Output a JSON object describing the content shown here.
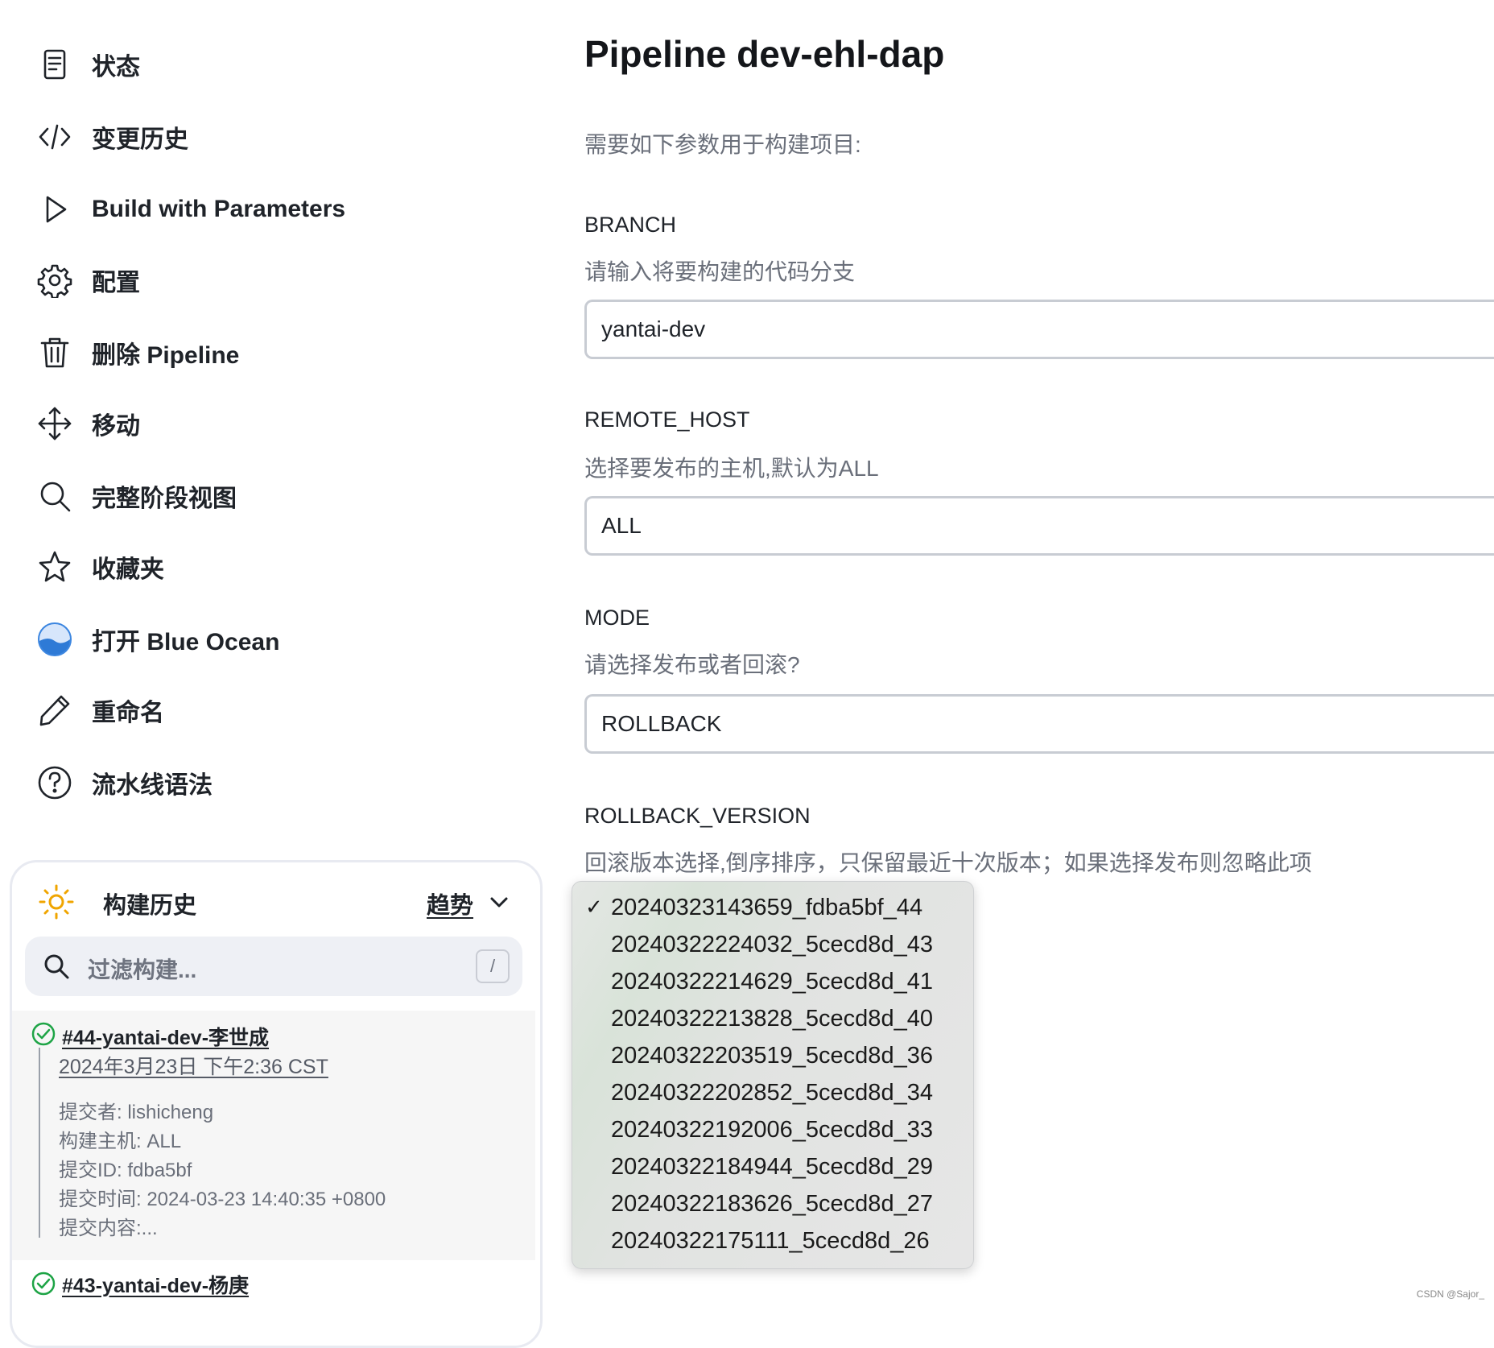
{
  "sidebar": {
    "items": [
      {
        "label": "状态",
        "icon": "document-icon"
      },
      {
        "label": "变更历史",
        "icon": "code-icon"
      },
      {
        "label": "Build with Parameters",
        "icon": "play-icon"
      },
      {
        "label": "配置",
        "icon": "gear-icon"
      },
      {
        "label": "删除 Pipeline",
        "icon": "trash-icon"
      },
      {
        "label": "移动",
        "icon": "move-icon"
      },
      {
        "label": "完整阶段视图",
        "icon": "search-icon"
      },
      {
        "label": "收藏夹",
        "icon": "star-icon"
      },
      {
        "label": "打开 Blue Ocean",
        "icon": "blue-ocean-icon"
      },
      {
        "label": "重命名",
        "icon": "pencil-icon"
      },
      {
        "label": "流水线语法",
        "icon": "help-icon"
      }
    ]
  },
  "build_history": {
    "title": "构建历史",
    "trend_label": "趋势",
    "search_placeholder": "过滤构建...",
    "search_shortcut": "/",
    "builds": [
      {
        "name": "#44-yantai-dev-李世成",
        "time": "2024年3月23日 下午2:36 CST",
        "details": [
          "提交者: lishicheng",
          "构建主机: ALL",
          "提交ID: fdba5bf",
          "提交时间: 2024-03-23 14:40:35 +0800",
          "提交内容:..."
        ]
      },
      {
        "name": "#43-yantai-dev-杨庚"
      }
    ]
  },
  "main": {
    "title": "Pipeline dev-ehl-dap",
    "intro": "需要如下参数用于构建项目:",
    "params": [
      {
        "name": "BRANCH",
        "description": "请输入将要构建的代码分支",
        "value": "yantai-dev"
      },
      {
        "name": "REMOTE_HOST",
        "description": "选择要发布的主机,默认为ALL",
        "value": "ALL"
      },
      {
        "name": "MODE",
        "description": "请选择发布或者回滚?",
        "value": "ROLLBACK"
      },
      {
        "name": "ROLLBACK_VERSION",
        "description": "回滚版本选择,倒序排序，只保留最近十次版本；如果选择发布则忽略此项"
      }
    ]
  },
  "dropdown": {
    "check_mark": "✓",
    "selected_index": 0,
    "options": [
      "20240323143659_fdba5bf_44",
      "20240322224032_5cecd8d_43",
      "20240322214629_5cecd8d_41",
      "20240322213828_5cecd8d_40",
      "20240322203519_5cecd8d_36",
      "20240322202852_5cecd8d_34",
      "20240322192006_5cecd8d_33",
      "20240322184944_5cecd8d_29",
      "20240322183626_5cecd8d_27",
      "20240322175111_5cecd8d_26"
    ]
  },
  "watermark": "CSDN @Sajor_"
}
